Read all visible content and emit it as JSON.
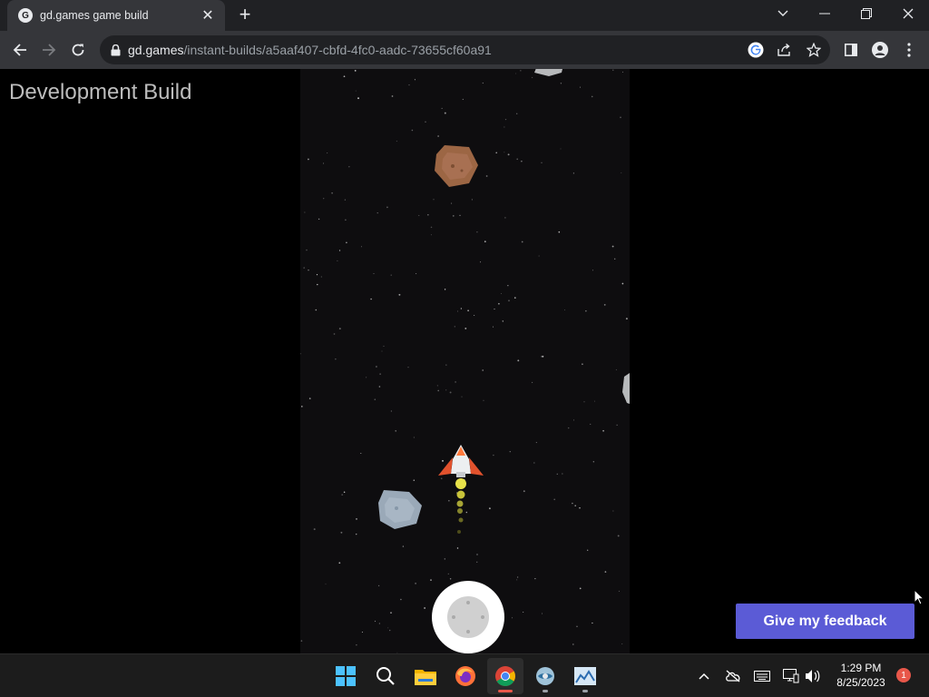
{
  "browser": {
    "tab": {
      "title": "gd.games game build",
      "favicon": "gdevelop-icon"
    },
    "new_tab_icon": "+",
    "address": {
      "host": "gd.games",
      "path": "/instant-builds/a5aaf407-cbfd-4fc0-aadc-73655cf60a91"
    }
  },
  "page": {
    "heading": "Development Build",
    "feedback_button": "Give my feedback",
    "accent_color": "#5b5bd6"
  },
  "game": {
    "elements": [
      "spaceship",
      "brown-asteroid",
      "grey-asteroid",
      "virtual-joystick"
    ]
  },
  "taskbar": {
    "apps": [
      "windows-start-icon",
      "search-icon",
      "file-explorer-icon",
      "firefox-icon",
      "chrome-icon",
      "app-icon",
      "chart-app-icon"
    ],
    "time": "1:29 PM",
    "date": "8/25/2023",
    "notification_count": "1"
  }
}
